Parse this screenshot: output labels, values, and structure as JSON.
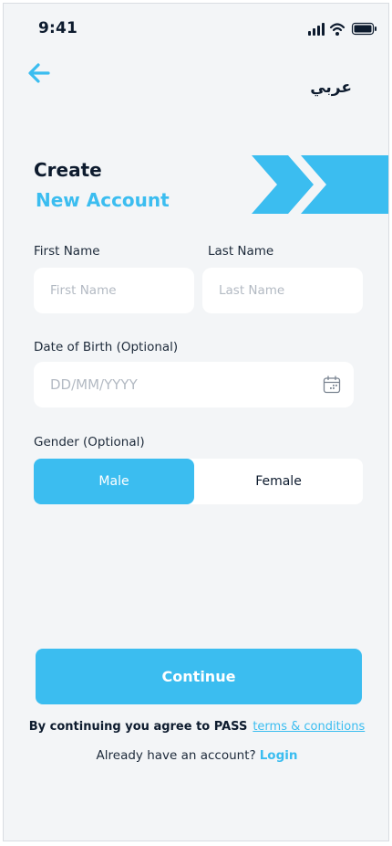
{
  "status_bar": {
    "time": "9:41"
  },
  "header": {
    "language_toggle": "عربي"
  },
  "title": {
    "line1": "Create",
    "line2": "New Account"
  },
  "form": {
    "first_name": {
      "label": "First Name",
      "placeholder": "First Name",
      "value": ""
    },
    "last_name": {
      "label": "Last  Name",
      "placeholder": "Last Name",
      "value": ""
    },
    "dob": {
      "label": "Date of Birth (Optional)",
      "placeholder": "DD/MM/YYYY",
      "value": ""
    },
    "gender": {
      "label": "Gender (Optional)",
      "options": [
        "Male",
        "Female"
      ],
      "selected": "Male"
    }
  },
  "actions": {
    "continue_label": "Continue",
    "agree_text": "By continuing you agree to PASS",
    "terms_link": "terms & conditions",
    "login_prompt": "Already have an account?",
    "login_link": "Login"
  },
  "colors": {
    "accent": "#3bbdf0",
    "text_dark": "#0d1b2e",
    "background": "#f3f5f7",
    "field_bg": "#ffffff",
    "placeholder": "#b3bac3"
  },
  "icons": [
    "signal-icon",
    "wifi-icon",
    "battery-icon",
    "back-arrow-icon",
    "calendar-icon",
    "chevron-decoration"
  ]
}
